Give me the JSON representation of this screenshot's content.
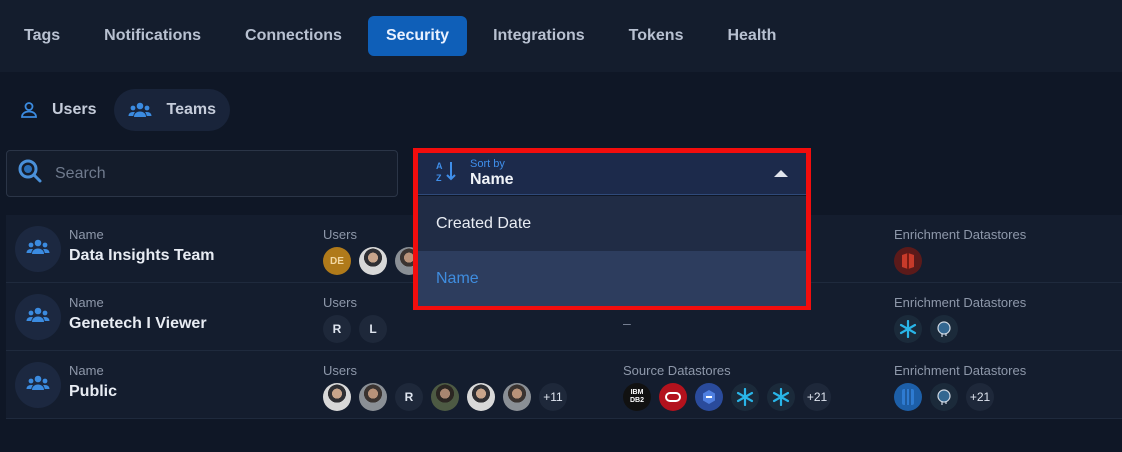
{
  "nav": {
    "tabs": [
      {
        "label": "Tags"
      },
      {
        "label": "Notifications"
      },
      {
        "label": "Connections"
      },
      {
        "label": "Security",
        "active": true
      },
      {
        "label": "Integrations"
      },
      {
        "label": "Tokens"
      },
      {
        "label": "Health"
      }
    ]
  },
  "subtabs": {
    "users": "Users",
    "teams": "Teams",
    "active": "Teams"
  },
  "search": {
    "placeholder": "Search"
  },
  "sort": {
    "label": "Sort by",
    "value": "Name",
    "options": [
      "Created Date",
      "Name"
    ],
    "selected": "Name"
  },
  "columns": {
    "name": "Name",
    "users": "Users",
    "source": "Source Datastores",
    "enrichment": "Enrichment Datastores"
  },
  "teams": [
    {
      "name": "Data Insights Team",
      "users": [
        "DE",
        "photo",
        "photo"
      ],
      "source_text": "",
      "enrichment": [
        "red-datastore-icon"
      ]
    },
    {
      "name": "Genetech I Viewer",
      "users": [
        "R",
        "L"
      ],
      "source_text": "–",
      "enrichment": [
        "snowflake-icon",
        "postgres-icon"
      ]
    },
    {
      "name": "Public",
      "users": [
        "photo",
        "photo",
        "R",
        "photo",
        "photo",
        "photo"
      ],
      "users_more": "+11",
      "source": [
        "ibm-db2-icon",
        "oracle-icon",
        "gcp-icon",
        "snowflake-icon",
        "snowflake-icon"
      ],
      "source_more": "+21",
      "enrichment": [
        "blue-datastore-icon",
        "postgres-icon"
      ],
      "enrichment_more": "+21"
    }
  ],
  "ibm_text": "IBM DB2",
  "colors": {
    "accent": "#0f5fb8",
    "highlight": "#f20d0d",
    "link": "#3f8ddf"
  }
}
